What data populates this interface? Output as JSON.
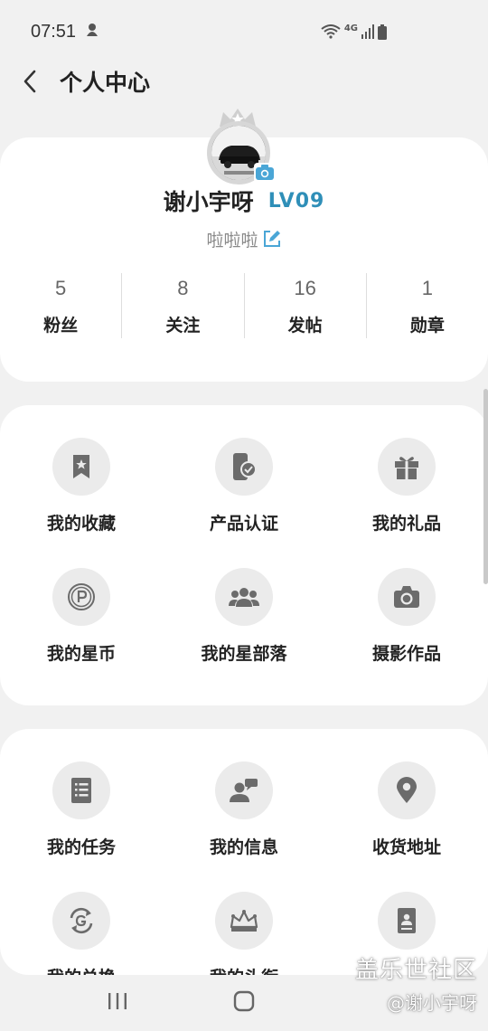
{
  "status_bar": {
    "time": "07:51",
    "network": "4G"
  },
  "header": {
    "title": "个人中心"
  },
  "profile": {
    "name": "谢小宇呀",
    "level": "LV09",
    "signature": "啦啦啦",
    "stats": [
      {
        "value": "5",
        "label": "粉丝"
      },
      {
        "value": "8",
        "label": "关注"
      },
      {
        "value": "16",
        "label": "发帖"
      },
      {
        "value": "1",
        "label": "勋章"
      }
    ]
  },
  "menu_a": [
    {
      "label": "我的收藏",
      "icon": "bookmark-star-icon"
    },
    {
      "label": "产品认证",
      "icon": "phone-check-icon"
    },
    {
      "label": "我的礼品",
      "icon": "gift-icon"
    },
    {
      "label": "我的星币",
      "icon": "coin-p-icon"
    },
    {
      "label": "我的星部落",
      "icon": "group-icon"
    },
    {
      "label": "摄影作品",
      "icon": "camera-icon"
    }
  ],
  "menu_b": [
    {
      "label": "我的任务",
      "icon": "task-list-icon"
    },
    {
      "label": "我的信息",
      "icon": "user-message-icon"
    },
    {
      "label": "收货地址",
      "icon": "location-pin-icon"
    },
    {
      "label": "我的兑换",
      "icon": "exchange-g-icon"
    },
    {
      "label": "我的头衔",
      "icon": "crown-icon"
    },
    {
      "label": "",
      "icon": "contact-card-icon"
    }
  ],
  "watermark": {
    "line1": "盖乐世社区",
    "line2": "@谢小宇呀"
  },
  "colors": {
    "level": "#2f8fb8",
    "camera_badge": "#4aa6d6",
    "edit_icon": "#4aa6d6",
    "icon_gray": "#6b6b6b"
  }
}
